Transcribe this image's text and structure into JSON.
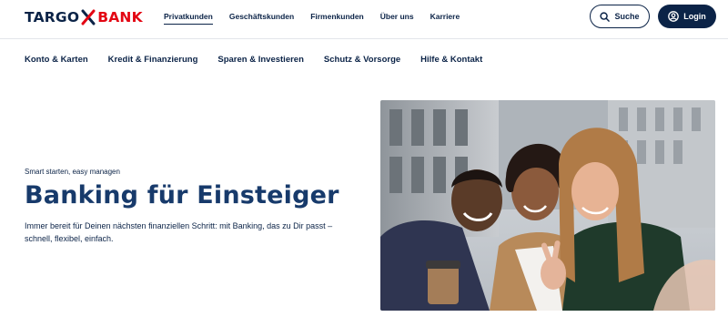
{
  "brand": {
    "name_left": "TARGO",
    "name_right": "BANK",
    "accent_color": "#e30613",
    "primary_color": "#0b2347"
  },
  "top_nav": [
    {
      "label": "Privatkunden",
      "active": true
    },
    {
      "label": "Geschäftskunden",
      "active": false
    },
    {
      "label": "Firmenkunden",
      "active": false
    },
    {
      "label": "Über uns",
      "active": false
    },
    {
      "label": "Karriere",
      "active": false
    }
  ],
  "actions": {
    "search_label": "Suche",
    "login_label": "Login",
    "search_icon": "search-icon",
    "login_icon": "user-circle-icon"
  },
  "sub_nav": [
    {
      "label": "Konto & Karten"
    },
    {
      "label": "Kredit & Finanzierung"
    },
    {
      "label": "Sparen & Investieren"
    },
    {
      "label": "Schutz & Vorsorge"
    },
    {
      "label": "Hilfe & Kontakt"
    }
  ],
  "hero": {
    "eyebrow": "Smart starten, easy managen",
    "title": "Banking für Einsteiger",
    "text": "Immer bereit für Deinen nächsten finanziellen Schritt: mit Banking, das zu Dir passt – schnell, flexibel, einfach."
  }
}
